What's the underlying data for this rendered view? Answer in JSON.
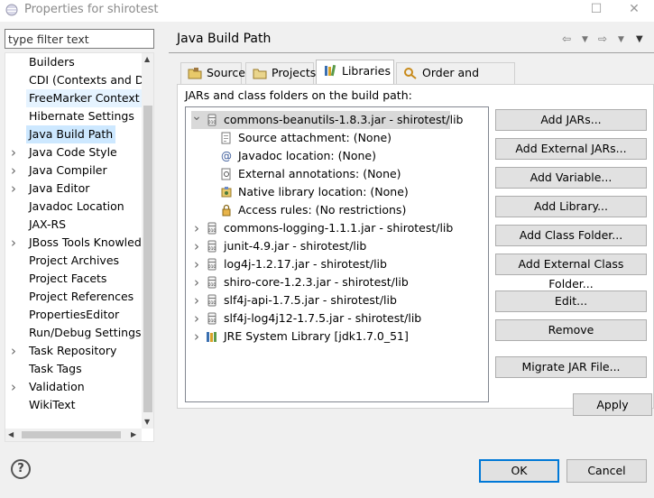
{
  "window": {
    "title": "Properties for shirotest"
  },
  "filter": {
    "placeholder": "type filter text"
  },
  "property_tree": [
    {
      "label": "Builders",
      "expandable": false
    },
    {
      "label": "CDI (Contexts and Dependency Injection)",
      "expandable": false
    },
    {
      "label": "FreeMarker Context",
      "expandable": false
    },
    {
      "label": "Hibernate Settings",
      "expandable": false
    },
    {
      "label": "Java Build Path",
      "expandable": false,
      "selected": true
    },
    {
      "label": "Java Code Style",
      "expandable": true
    },
    {
      "label": "Java Compiler",
      "expandable": true
    },
    {
      "label": "Java Editor",
      "expandable": true
    },
    {
      "label": "Javadoc Location",
      "expandable": false
    },
    {
      "label": "JAX-RS",
      "expandable": false
    },
    {
      "label": "JBoss Tools Knowledge Base",
      "expandable": true
    },
    {
      "label": "Project Archives",
      "expandable": false
    },
    {
      "label": "Project Facets",
      "expandable": false
    },
    {
      "label": "Project References",
      "expandable": false
    },
    {
      "label": "PropertiesEditor",
      "expandable": false
    },
    {
      "label": "Run/Debug Settings",
      "expandable": false
    },
    {
      "label": "Task Repository",
      "expandable": true
    },
    {
      "label": "Task Tags",
      "expandable": false
    },
    {
      "label": "Validation",
      "expandable": true
    },
    {
      "label": "WikiText",
      "expandable": false
    }
  ],
  "page": {
    "title": "Java Build Path",
    "tabs": [
      "Source",
      "Projects",
      "Libraries",
      "Order and Export"
    ],
    "active_tab": "Libraries",
    "list_label": "JARs and class folders on the build path:"
  },
  "libraries": [
    {
      "label": "commons-beanutils-1.8.3.jar - shirotest/lib",
      "expanded": true,
      "selected": true
    },
    {
      "label": "Source attachment: (None)",
      "child": true,
      "icon": "source-attachment-icon"
    },
    {
      "label": "Javadoc location: (None)",
      "child": true,
      "icon": "javadoc-icon"
    },
    {
      "label": "External annotations: (None)",
      "child": true,
      "icon": "annotations-icon"
    },
    {
      "label": "Native library location: (None)",
      "child": true,
      "icon": "native-library-icon"
    },
    {
      "label": "Access rules: (No restrictions)",
      "child": true,
      "icon": "access-rules-icon"
    },
    {
      "label": "commons-logging-1.1.1.jar - shirotest/lib"
    },
    {
      "label": "junit-4.9.jar - shirotest/lib"
    },
    {
      "label": "log4j-1.2.17.jar - shirotest/lib"
    },
    {
      "label": "shiro-core-1.2.3.jar - shirotest/lib"
    },
    {
      "label": "slf4j-api-1.7.5.jar - shirotest/lib"
    },
    {
      "label": "slf4j-log4j12-1.7.5.jar - shirotest/lib"
    },
    {
      "label": "JRE System Library [jdk1.7.0_51]",
      "icon": "jre-library-icon"
    }
  ],
  "buttons": {
    "add_jars": "Add JARs...",
    "add_external_jars": "Add External JARs...",
    "add_variable": "Add Variable...",
    "add_library": "Add Library...",
    "add_class_folder": "Add Class Folder...",
    "add_external_class_folder": "Add External Class Folder...",
    "edit": "Edit...",
    "remove": "Remove",
    "migrate_jar": "Migrate JAR File...",
    "apply": "Apply",
    "ok": "OK",
    "cancel": "Cancel"
  },
  "colors": {
    "selection": "#cde8ff",
    "focus_border": "#0078d7",
    "jar_selected": "#d9d9d9"
  }
}
